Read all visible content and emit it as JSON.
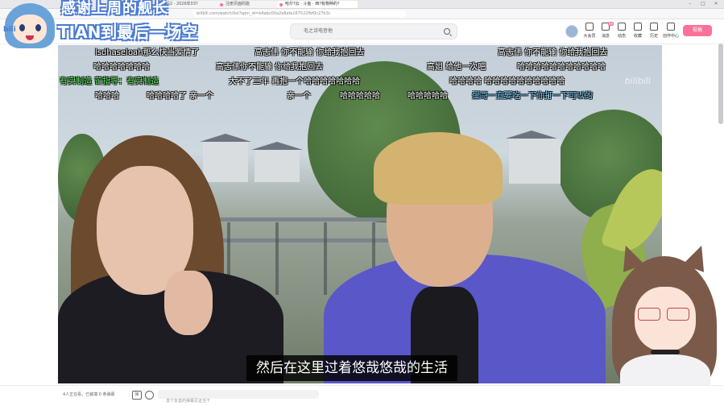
{
  "browser": {
    "tabs": [
      {
        "label": "码2 · 2026年03?",
        "active": false
      },
      {
        "label": "注册页面的能",
        "active": false
      },
      {
        "label": "哈尔?云 · 斗鱼 · 西?有物种的?",
        "active": true
      }
    ],
    "url": "bilibili.com/watch/list?spm_id=b4abc00a2e8afa167522fbf0c27b3c"
  },
  "header": {
    "search_placeholder": "毛之诗电音他",
    "nav": [
      {
        "label": "大会员",
        "badge": ""
      },
      {
        "label": "消息",
        "badge": "99"
      },
      {
        "label": "动态",
        "badge": ""
      },
      {
        "label": "收藏",
        "badge": ""
      },
      {
        "label": "历史",
        "badge": ""
      },
      {
        "label": "创作中心",
        "badge": ""
      }
    ],
    "post_button": "投稿"
  },
  "overlay": {
    "banner_title": "感谢上周的舰长",
    "banner_sub": "TIAN到最后一场空",
    "logo_text": "bili"
  },
  "video": {
    "watermark": "bilibili",
    "subtitle": "然后在这里过着悠哉悠哉的生活",
    "danmaku": [
      {
        "text": "lsdhaseloah那么快当爱情了",
        "row": 0,
        "color": "white"
      },
      {
        "text": "高志伟  你不能输  你给我抱回去",
        "row": 0,
        "color": "white"
      },
      {
        "text": "高志伟  你不能输  你给我抱回去",
        "row": 0,
        "color": "white"
      },
      {
        "text": "哈哈哈哈哈哈哈",
        "row": 1,
        "color": "white"
      },
      {
        "text": "高志伟你不能输  你给我抱回去",
        "row": 1,
        "color": "white"
      },
      {
        "text": "高姐  给他一次吧",
        "row": 1,
        "color": "white"
      },
      {
        "text": "哈哈哈哈哈哈哈哈哈哈哈",
        "row": 1,
        "color": "white"
      },
      {
        "text": "有实制造  芒指导：有实制造",
        "row": 2,
        "color": "green"
      },
      {
        "text": "大不了三年  再抱一个哈哈哈哈哈哈哈",
        "row": 2,
        "color": "white"
      },
      {
        "text": "哈哈哈哈  哈哈哈哈哈哈哈哈哈哈",
        "row": 2,
        "color": "white"
      },
      {
        "text": "哈哈哈",
        "row": 3,
        "color": "white"
      },
      {
        "text": "哈哈哈哈了  亲一个",
        "row": 3,
        "color": "white"
      },
      {
        "text": "亲一个",
        "row": 3,
        "color": "white"
      },
      {
        "text": "哈哈哈哈哈",
        "row": 3,
        "color": "white"
      },
      {
        "text": "哈哈哈哈哈",
        "row": 3,
        "color": "white"
      },
      {
        "text": "蛋哥一直要吃一下你打一下可以的",
        "row": 3,
        "color": "blue"
      }
    ]
  },
  "bottom": {
    "viewer_info": "4人正在看，已装填 0 条弹幕",
    "danmaku_toggle_label": "弹",
    "danmaku_placeholder": "发个友善的弹幕见证当下"
  },
  "colors": {
    "brand_pink": "#fb7299",
    "banner_outline": "#4a7bd1",
    "jacket_purple": "#5a57c9"
  }
}
